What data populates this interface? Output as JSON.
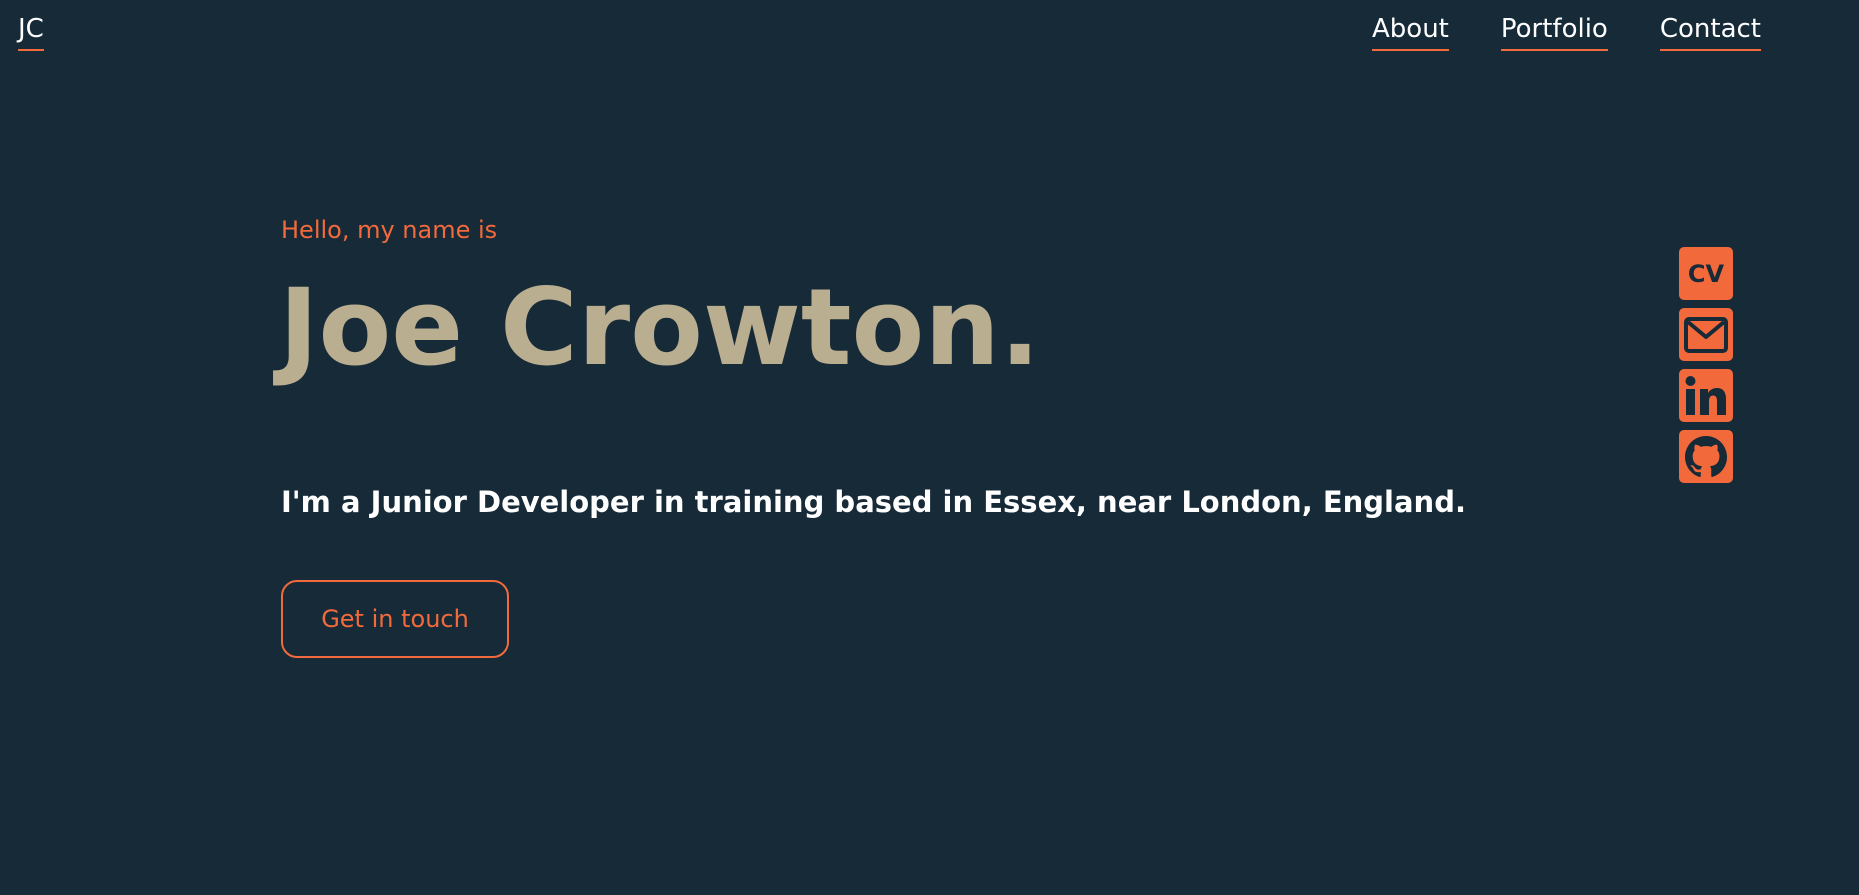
{
  "header": {
    "logo": "JC",
    "nav": [
      {
        "label": "About"
      },
      {
        "label": "Portfolio"
      },
      {
        "label": "Contact"
      }
    ]
  },
  "hero": {
    "greeting": "Hello, my name is",
    "name": "Joe Crowton.",
    "tagline": "I'm a Junior Developer in training based in Essex, near London, England.",
    "cta_label": "Get in touch"
  },
  "social": {
    "cv_label": "CV",
    "icons": [
      "cv-icon",
      "mail-icon",
      "linkedin-icon",
      "github-icon"
    ]
  },
  "colors": {
    "background": "#172a38",
    "accent": "#f26a3b",
    "name": "#baae90",
    "text": "#ffffff"
  }
}
